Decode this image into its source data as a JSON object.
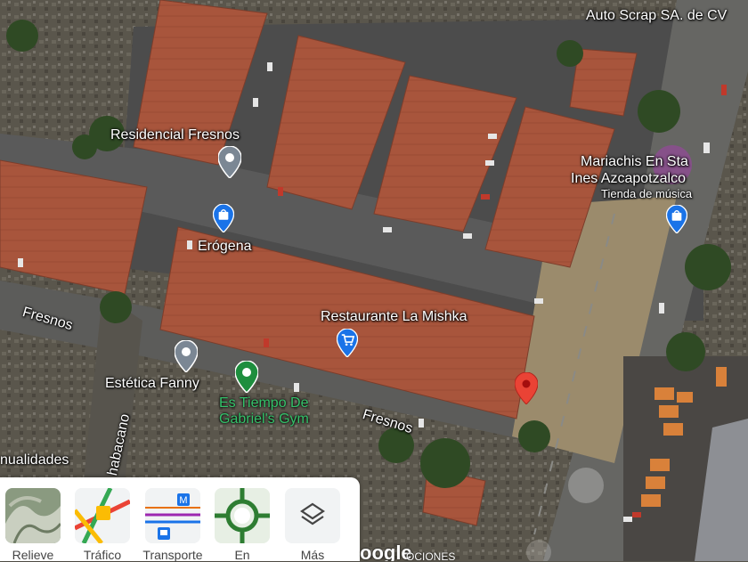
{
  "map": {
    "places": [
      {
        "name": "Auto Scrap SA. de CV"
      },
      {
        "name": "Residencial Fresnos"
      },
      {
        "name": "Mariachis En Sta Ines Azcapotzalco"
      },
      {
        "name": "Tienda de música"
      },
      {
        "name": "Erógena"
      },
      {
        "name": "Restaurante La Mishka"
      },
      {
        "name": "Estética Fanny"
      },
      {
        "name": "Es Tiempo De Gabriel's Gym"
      },
      {
        "name": "nualidades"
      }
    ],
    "streets": [
      "Fresnos",
      "Fresnos",
      "habacano"
    ],
    "mariachis_line1": "Mariachis En Sta",
    "mariachis_line2": "Ines Azcapotzalco",
    "gym_line1": "Es Tiempo De",
    "gym_line2": "Gabriel's Gym",
    "colors": {
      "roof": "#a8553c",
      "pin_gray": "#7b8794",
      "pin_blue": "#1a73e8",
      "pin_green": "#1e8e3e",
      "pin_red": "#ea4335",
      "label_green": "#34c26a"
    }
  },
  "layers": {
    "items": [
      {
        "label": "Relieve",
        "icon": "terrain-icon"
      },
      {
        "label": "Tráfico",
        "icon": "traffic-icon"
      },
      {
        "label": "Transporte",
        "icon": "transit-icon"
      },
      {
        "label": "En",
        "icon": "biking-icon"
      },
      {
        "label": "Más",
        "icon": "layers-icon"
      }
    ]
  },
  "footer": {
    "logo": "oogle",
    "scale": "OCIONES"
  }
}
